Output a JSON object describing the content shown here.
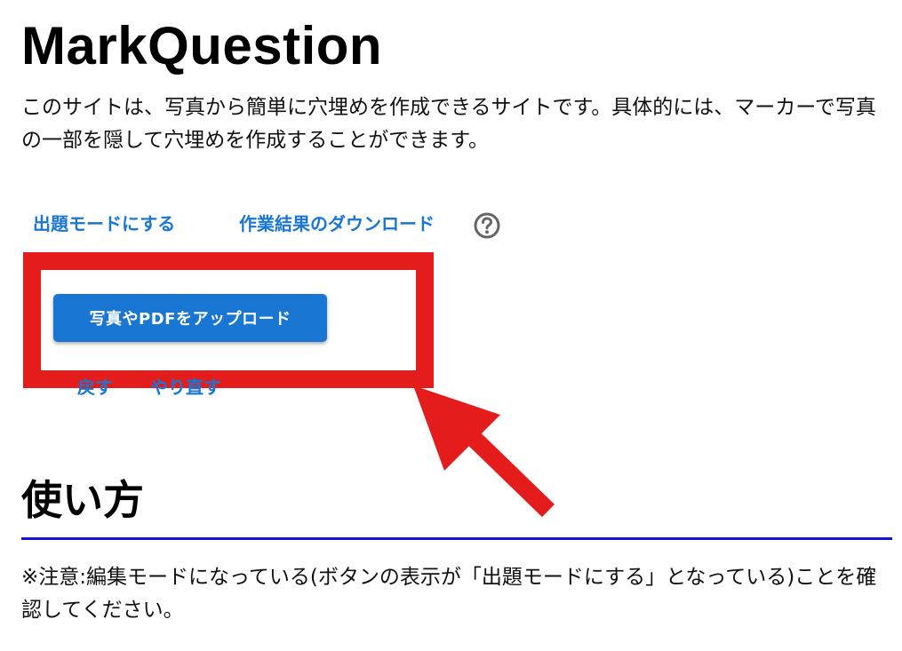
{
  "header": {
    "title": "MarkQuestion",
    "description": "このサイトは、写真から簡単に穴埋めを作成できるサイトです。具体的には、マーカーで写真の一部を隠して穴埋めを作成することができます。"
  },
  "toolbar": {
    "mode_link": "出題モードにする",
    "download_link": "作業結果のダウンロード",
    "help_icon": "question-circle-icon"
  },
  "upload": {
    "button_label": "写真やPDFをアップロード"
  },
  "history": {
    "undo_label": "戻す",
    "redo_label": "やり直す"
  },
  "howto": {
    "heading": "使い方",
    "note": "※注意:編集モードになっている(ボタンの表示が「出題モードにする」となっている)ことを確認してください。"
  },
  "colors": {
    "link": "#1976d2",
    "button_bg": "#1976d2",
    "highlight": "#e41c1c",
    "rule": "#1414d2"
  }
}
